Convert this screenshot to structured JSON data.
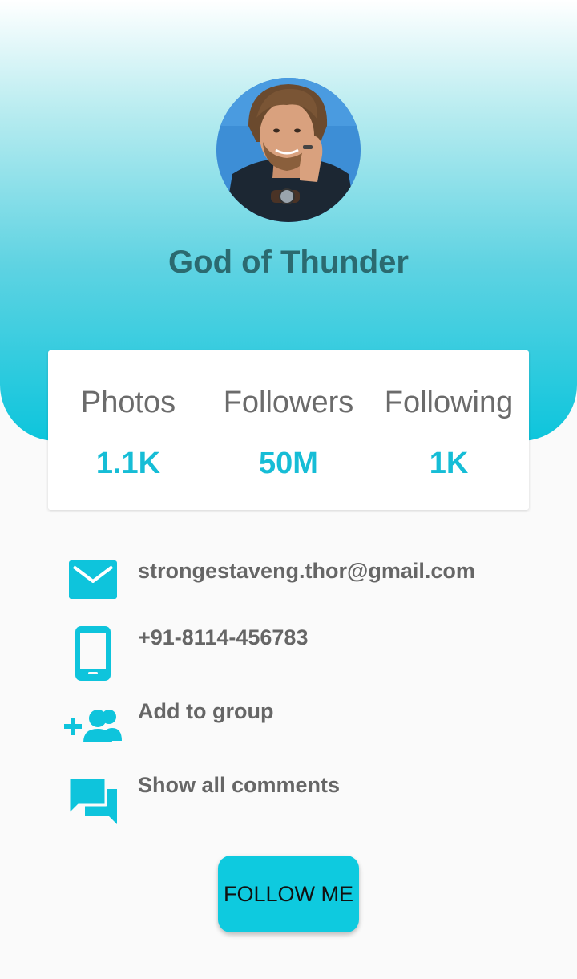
{
  "profile": {
    "name": "God of Thunder"
  },
  "stats": [
    {
      "label": "Photos",
      "value": "1.1K"
    },
    {
      "label": "Followers",
      "value": "50M"
    },
    {
      "label": "Following",
      "value": "1K"
    }
  ],
  "info": {
    "email": "strongestaveng.thor@gmail.com",
    "phone": "+91-8114-456783",
    "add_group": "Add to group",
    "comments": "Show all comments"
  },
  "icons": {
    "email": "email-icon",
    "phone": "phone-icon",
    "add_group": "group-add-icon",
    "comments": "comments-icon"
  },
  "follow_button": {
    "label": "FOLLOW ME"
  },
  "colors": {
    "accent": "#0dc5dc",
    "stat_value": "#16bdd6",
    "name": "#2b6a70",
    "text": "#666666"
  }
}
